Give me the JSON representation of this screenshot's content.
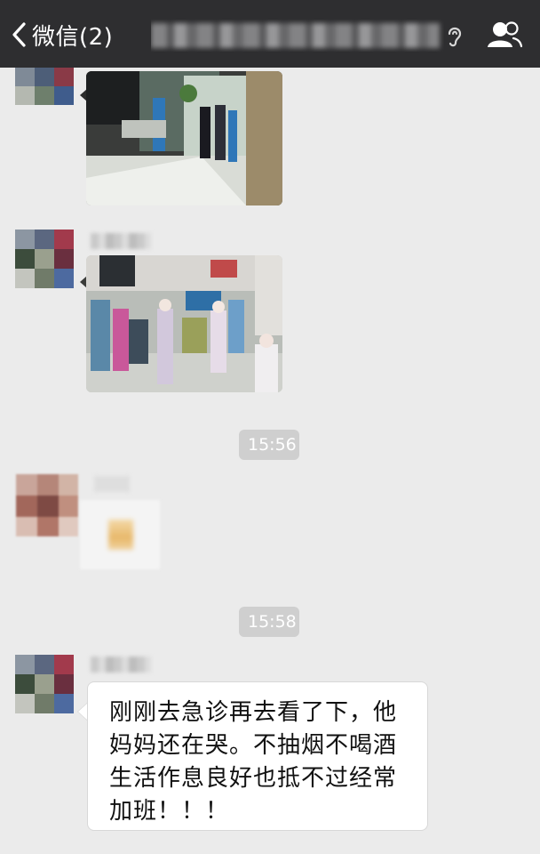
{
  "navbar": {
    "back_label": "微信(2)",
    "title": "",
    "icons": [
      "back-chevron-icon",
      "ear-icon",
      "group-members-icon"
    ]
  },
  "messages": [
    {
      "type": "image",
      "description_hidden": true
    },
    {
      "type": "image",
      "description_hidden": true
    },
    {
      "type": "timestamp",
      "text": "15:56"
    },
    {
      "type": "sticker"
    },
    {
      "type": "timestamp",
      "text": "15:58"
    },
    {
      "type": "text",
      "lines": [
        "刚刚去急诊再去看了下，他",
        "妈妈还在哭。不抽烟不喝酒",
        "生活作息良好也抵不过经常",
        "加班！！！"
      ]
    }
  ],
  "timestamps": {
    "t1": "15:56",
    "t2": "15:58"
  },
  "bubble": {
    "line1": "刚刚去急诊再去看了下，他",
    "line2": "妈妈还在哭。不抽烟不喝酒",
    "line3": "生活作息良好也抵不过经常",
    "line4": "加班！！！"
  },
  "colors": {
    "navbar_bg": "#2e2e30",
    "chat_bg": "#ebebeb",
    "timestamp_bg": "#cfcfcf",
    "bubble_bg": "#ffffff"
  }
}
